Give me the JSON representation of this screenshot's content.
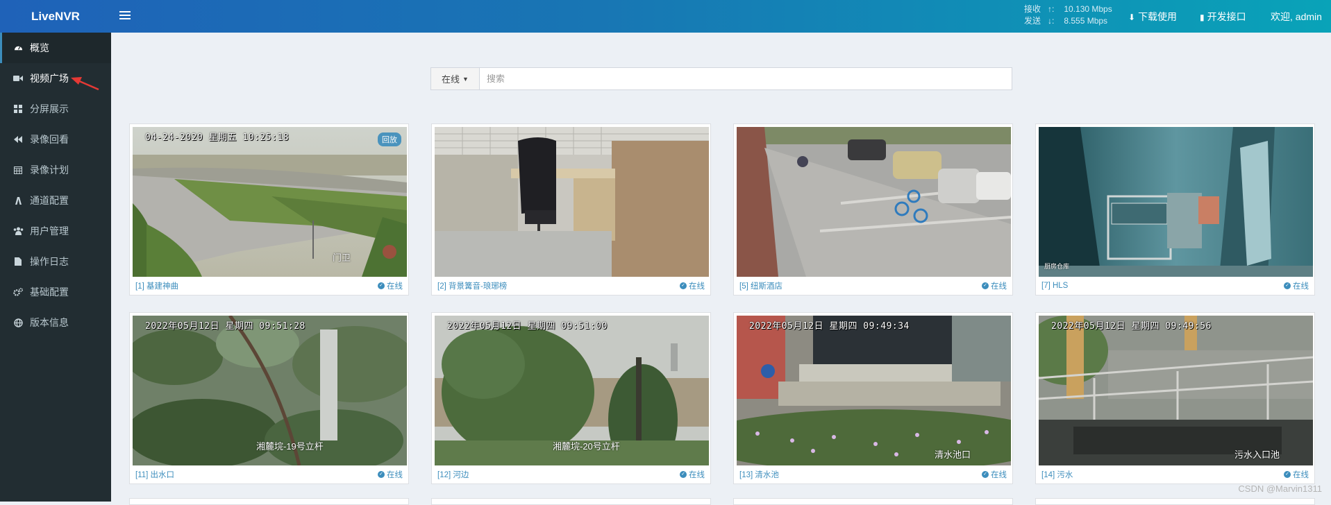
{
  "app": {
    "title": "LiveNVR"
  },
  "topbar": {
    "recv_label": "接收",
    "recv_value": "10.130 Mbps",
    "send_label": "发送",
    "send_value": "8.555 Mbps",
    "download_label": "下载使用",
    "api_label": "开发接口",
    "welcome": "欢迎, admin"
  },
  "sidebar": {
    "items": [
      {
        "label": "概览",
        "icon": "dashboard-icon"
      },
      {
        "label": "视频广场",
        "icon": "video-camera-icon"
      },
      {
        "label": "分屏展示",
        "icon": "grid-icon"
      },
      {
        "label": "录像回看",
        "icon": "rewind-icon"
      },
      {
        "label": "录像计划",
        "icon": "calendar-icon"
      },
      {
        "label": "通道配置",
        "icon": "channel-icon"
      },
      {
        "label": "用户管理",
        "icon": "users-icon"
      },
      {
        "label": "操作日志",
        "icon": "file-icon"
      },
      {
        "label": "基础配置",
        "icon": "cogs-icon"
      },
      {
        "label": "版本信息",
        "icon": "globe-icon"
      }
    ]
  },
  "search": {
    "filter": "在线",
    "placeholder": "搜索"
  },
  "cards": [
    {
      "name": "[1] 基建神曲",
      "status": "在线",
      "osd": "04-24-2020  星期五  10:25:18",
      "badge": "回放",
      "caption": "门卫"
    },
    {
      "name": "[2] 背景篝音-琅琊榜",
      "status": "在线",
      "osd": "",
      "badge": "",
      "caption": ""
    },
    {
      "name": "[5] 纽斯酒店",
      "status": "在线",
      "osd": "",
      "badge": "",
      "caption": ""
    },
    {
      "name": "[7] HLS",
      "status": "在线",
      "osd": "",
      "badge": "",
      "caption": "厨房仓库"
    },
    {
      "name": "[11] 出水口",
      "status": "在线",
      "osd": "2022年05月12日  星期四  09:51:28",
      "badge": "",
      "caption": "湘麓垸-19号立杆"
    },
    {
      "name": "[12] 河边",
      "status": "在线",
      "osd": "2022年05月12日  星期四  09:51:00",
      "badge": "",
      "caption": "湘麓垸-20号立杆"
    },
    {
      "name": "[13] 清水池",
      "status": "在线",
      "osd": "2022年05月12日  星期四  09:49:34",
      "badge": "",
      "caption": "清水池口"
    },
    {
      "name": "[14] 污水",
      "status": "在线",
      "osd": "2022年05月12日  星期四  09:49:56",
      "badge": "",
      "caption": "污水入口池"
    }
  ],
  "watermark": "CSDN @Marvin1311",
  "colors": {
    "accent": "#3c8dbc",
    "sidebar_bg": "#222d32",
    "content_bg": "#ecf0f5",
    "arrow": "#e53935"
  }
}
